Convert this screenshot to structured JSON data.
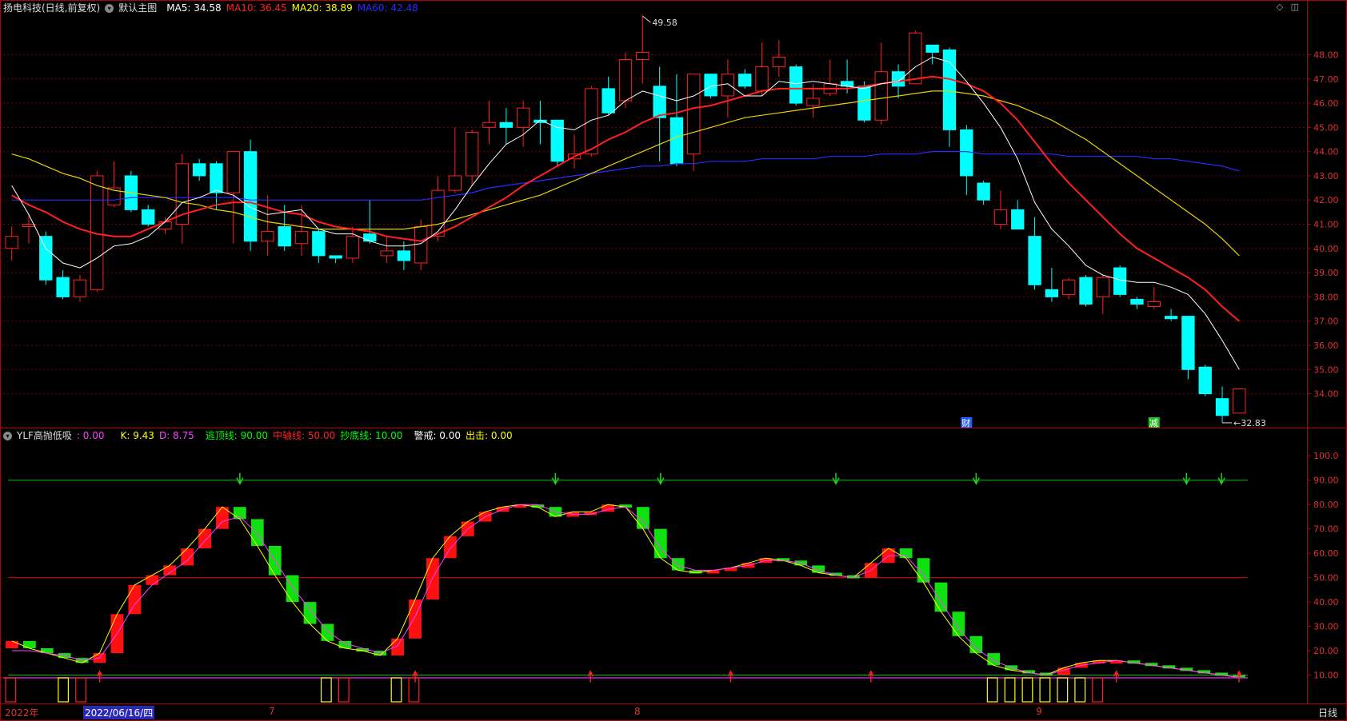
{
  "main": {
    "title": "扬电科技(日线,前复权)",
    "chart_name": "默认主图",
    "ma": [
      {
        "label": "MA5: 34.58",
        "color": "#ffffff"
      },
      {
        "label": "MA10: 36.45",
        "color": "#ff2020"
      },
      {
        "label": "MA20: 38.89",
        "color": "#ffff00"
      },
      {
        "label": "MA60: 42.48",
        "color": "#2b2bff"
      }
    ],
    "high_label": "49.58",
    "low_label": "32.83",
    "event_labels": [
      "财",
      "减"
    ]
  },
  "indicator": {
    "name": "YLF高抛低吸",
    "values": [
      {
        "label": ": 0.00",
        "color": "#ff40ff"
      },
      {
        "label": "K: 9.43",
        "color": "#ffff00"
      },
      {
        "label": "D: 8.75",
        "color": "#ff40ff"
      },
      {
        "label": "逃顶线: 90.00",
        "color": "#00ff00"
      },
      {
        "label": "中轴线: 50.00",
        "color": "#ff2020"
      },
      {
        "label": "抄底线: 10.00",
        "color": "#00ff00"
      },
      {
        "label": "警戒: 0.00",
        "color": "#ffffff"
      },
      {
        "label": "出击: 0.00",
        "color": "#ffff00"
      }
    ]
  },
  "footer": {
    "year_label": "2022年",
    "selected_date": "2022/06/16/四",
    "months": [
      "7",
      "8",
      "9"
    ],
    "period": "日线"
  },
  "colors": {
    "up": "#ff2020",
    "down": "#00ffff",
    "ma5": "#ffffff",
    "ma10": "#ff2020",
    "ma20": "#e6d200",
    "ma60": "#2b2bff",
    "k_up": "#ff1010",
    "k_down": "#10e010",
    "grid": "#7a0000",
    "border": "#b00000"
  },
  "chart_data": [
    {
      "type": "candlestick",
      "title": "扬电科技(日线,前复权)",
      "ylim": [
        32.6,
        49.6
      ],
      "yticks": [
        "34.00",
        "35.00",
        "36.00",
        "37.00",
        "38.00",
        "39.00",
        "40.00",
        "41.00",
        "42.00",
        "43.00",
        "44.00",
        "45.00",
        "46.00",
        "47.00",
        "48.00"
      ],
      "ohlc": [
        [
          40.0,
          40.5,
          39.5,
          40.9
        ],
        [
          40.9,
          41.0,
          40.2,
          41.4
        ],
        [
          40.5,
          38.7,
          38.5,
          40.7
        ],
        [
          38.8,
          38.0,
          37.9,
          39.1
        ],
        [
          38.0,
          38.7,
          37.8,
          38.9
        ],
        [
          38.3,
          43.0,
          38.2,
          43.2
        ],
        [
          41.8,
          42.5,
          41.7,
          43.6
        ],
        [
          43.0,
          41.6,
          41.5,
          43.2
        ],
        [
          41.6,
          41.0,
          40.9,
          41.8
        ],
        [
          40.8,
          41.1,
          40.6,
          41.3
        ],
        [
          41.0,
          43.5,
          40.2,
          43.9
        ],
        [
          43.5,
          43.0,
          42.8,
          43.7
        ],
        [
          43.5,
          42.3,
          41.6,
          43.6
        ],
        [
          42.3,
          44.0,
          40.2,
          44.0
        ],
        [
          44.0,
          40.3,
          39.9,
          44.5
        ],
        [
          40.3,
          40.7,
          39.7,
          42.2
        ],
        [
          40.9,
          40.1,
          39.9,
          41.8
        ],
        [
          40.2,
          40.7,
          39.7,
          41.8
        ],
        [
          40.7,
          39.7,
          39.4,
          40.8
        ],
        [
          39.7,
          39.6,
          39.4,
          39.7
        ],
        [
          39.6,
          40.5,
          39.4,
          40.9
        ],
        [
          40.6,
          40.3,
          40.2,
          42.0
        ],
        [
          39.7,
          39.9,
          39.4,
          40.5
        ],
        [
          39.9,
          39.5,
          39.1,
          40.3
        ],
        [
          39.4,
          40.9,
          39.1,
          41.2
        ],
        [
          40.5,
          42.4,
          40.3,
          43.0
        ],
        [
          42.4,
          43.0,
          42.3,
          45.0
        ],
        [
          43.0,
          44.8,
          42.6,
          44.9
        ],
        [
          45.0,
          45.2,
          44.3,
          46.1
        ],
        [
          45.2,
          45.0,
          44.3,
          45.8
        ],
        [
          45.0,
          45.8,
          44.2,
          46.1
        ],
        [
          45.3,
          45.2,
          44.3,
          46.1
        ],
        [
          45.3,
          43.6,
          43.4,
          45.3
        ],
        [
          43.7,
          43.9,
          43.3,
          44.7
        ],
        [
          43.9,
          46.6,
          43.8,
          46.7
        ],
        [
          46.6,
          45.6,
          45.5,
          47.1
        ],
        [
          46.1,
          47.8,
          45.8,
          48.1
        ],
        [
          47.8,
          48.1,
          46.8,
          49.6
        ],
        [
          46.7,
          45.4,
          43.6,
          47.5
        ],
        [
          45.4,
          43.5,
          43.4,
          47.2
        ],
        [
          43.9,
          47.2,
          43.2,
          47.2
        ],
        [
          47.2,
          46.3,
          46.2,
          47.2
        ],
        [
          46.3,
          47.2,
          45.4,
          47.8
        ],
        [
          47.2,
          46.7,
          46.6,
          47.4
        ],
        [
          46.5,
          47.5,
          46.3,
          48.5
        ],
        [
          47.5,
          47.9,
          47.1,
          48.6
        ],
        [
          47.5,
          46.0,
          45.9,
          47.6
        ],
        [
          45.9,
          46.2,
          45.4,
          46.8
        ],
        [
          46.4,
          46.8,
          46.3,
          47.8
        ],
        [
          46.9,
          46.7,
          46.4,
          47.8
        ],
        [
          46.7,
          45.3,
          45.2,
          46.9
        ],
        [
          45.3,
          47.3,
          45.1,
          48.5
        ],
        [
          47.3,
          46.7,
          46.2,
          47.6
        ],
        [
          46.8,
          48.9,
          46.8,
          49.0
        ],
        [
          48.4,
          48.1,
          47.6,
          48.4
        ],
        [
          48.2,
          44.9,
          44.2,
          48.3
        ],
        [
          44.9,
          43.0,
          42.2,
          45.1
        ],
        [
          42.7,
          42.0,
          41.8,
          42.8
        ],
        [
          41.0,
          41.6,
          40.8,
          42.4
        ],
        [
          41.6,
          40.8,
          40.8,
          42.0
        ],
        [
          40.5,
          38.5,
          38.3,
          41.3
        ],
        [
          38.3,
          38.0,
          37.8,
          39.2
        ],
        [
          38.1,
          38.7,
          37.9,
          38.8
        ],
        [
          38.8,
          37.7,
          37.6,
          38.9
        ],
        [
          38.0,
          38.8,
          37.3,
          38.9
        ],
        [
          39.2,
          38.1,
          38.0,
          39.3
        ],
        [
          37.9,
          37.7,
          37.5,
          38.0
        ],
        [
          37.6,
          37.8,
          37.5,
          38.4
        ],
        [
          37.2,
          37.1,
          37.0,
          37.5
        ],
        [
          37.2,
          35.0,
          34.6,
          37.2
        ],
        [
          35.1,
          34.0,
          33.9,
          35.2
        ],
        [
          33.8,
          33.1,
          32.8,
          34.3
        ],
        [
          33.2,
          34.2,
          33.2,
          34.2
        ]
      ],
      "ma5": [
        42.6,
        41.4,
        40.0,
        39.4,
        39.2,
        39.6,
        40.1,
        40.2,
        40.5,
        41.1,
        41.9,
        42.1,
        42.4,
        42.2,
        41.7,
        41.4,
        41.5,
        41.6,
        40.8,
        40.6,
        40.6,
        40.3,
        40.1,
        40.1,
        40.2,
        40.7,
        41.6,
        42.6,
        43.5,
        44.3,
        44.7,
        45.3,
        45.0,
        44.9,
        45.3,
        45.5,
        46.1,
        46.5,
        46.3,
        46.1,
        46.3,
        46.7,
        46.8,
        46.3,
        46.3,
        46.9,
        46.8,
        46.9,
        46.8,
        46.7,
        46.6,
        46.8,
        46.9,
        47.5,
        47.9,
        47.7,
        46.9,
        46.0,
        45.0,
        43.7,
        41.9,
        40.8,
        40.1,
        39.3,
        38.9,
        38.7,
        38.6,
        38.6,
        38.4,
        38.1,
        37.3,
        36.2,
        35.0
      ],
      "ma10": [
        42.2,
        41.8,
        41.5,
        41.1,
        40.8,
        40.6,
        40.5,
        40.5,
        40.8,
        41.1,
        41.4,
        41.6,
        41.8,
        41.9,
        41.9,
        41.7,
        41.5,
        41.4,
        41.1,
        40.9,
        40.8,
        40.7,
        40.5,
        40.4,
        40.3,
        40.6,
        40.9,
        41.3,
        41.7,
        42.1,
        42.6,
        43.0,
        43.4,
        43.8,
        44.1,
        44.5,
        44.8,
        45.2,
        45.5,
        45.6,
        45.8,
        45.9,
        46.1,
        46.3,
        46.5,
        46.6,
        46.6,
        46.6,
        46.6,
        46.6,
        46.7,
        46.8,
        46.9,
        47.0,
        47.1,
        47.0,
        46.8,
        46.5,
        46.0,
        45.3,
        44.4,
        43.5,
        42.7,
        42.0,
        41.3,
        40.6,
        40.0,
        39.6,
        39.2,
        38.8,
        38.3,
        37.6,
        37.0
      ],
      "ma20": [
        43.9,
        43.7,
        43.4,
        43.1,
        42.9,
        42.6,
        42.4,
        42.3,
        42.2,
        42.1,
        41.9,
        41.8,
        41.6,
        41.5,
        41.3,
        41.1,
        41.0,
        40.9,
        40.8,
        40.8,
        40.8,
        40.8,
        40.8,
        40.8,
        40.9,
        41.0,
        41.2,
        41.4,
        41.6,
        41.8,
        42.0,
        42.2,
        42.5,
        42.8,
        43.1,
        43.4,
        43.7,
        44.0,
        44.3,
        44.6,
        44.8,
        45.0,
        45.2,
        45.4,
        45.5,
        45.6,
        45.7,
        45.8,
        45.9,
        46.0,
        46.1,
        46.2,
        46.3,
        46.4,
        46.5,
        46.5,
        46.4,
        46.3,
        46.1,
        45.9,
        45.6,
        45.3,
        44.9,
        44.5,
        44.0,
        43.5,
        43.0,
        42.5,
        42.0,
        41.5,
        41.0,
        40.4,
        39.7
      ],
      "ma60": [
        42.0,
        42.0,
        42.0,
        42.0,
        42.0,
        42.0,
        42.0,
        42.1,
        42.1,
        42.1,
        42.1,
        42.1,
        42.1,
        42.1,
        42.0,
        42.0,
        42.0,
        42.0,
        42.0,
        42.0,
        42.0,
        42.0,
        42.0,
        42.0,
        42.0,
        42.1,
        42.2,
        42.3,
        42.5,
        42.6,
        42.7,
        42.8,
        42.9,
        43.0,
        43.1,
        43.2,
        43.3,
        43.4,
        43.4,
        43.5,
        43.5,
        43.6,
        43.6,
        43.6,
        43.7,
        43.7,
        43.7,
        43.7,
        43.8,
        43.8,
        43.8,
        43.9,
        43.9,
        43.9,
        44.0,
        44.0,
        44.0,
        43.9,
        43.9,
        43.9,
        43.9,
        43.9,
        43.8,
        43.8,
        43.8,
        43.8,
        43.8,
        43.7,
        43.7,
        43.6,
        43.5,
        43.4,
        43.2
      ]
    },
    {
      "type": "indicator",
      "title": "YLF高抛低吸",
      "ylim": [
        0,
        105
      ],
      "yticks": [
        "10.00",
        "20.00",
        "30.00",
        "40.00",
        "50.00",
        "60.00",
        "70.00",
        "80.00",
        "90.00",
        "100.0"
      ],
      "levels": [
        90,
        50,
        10
      ],
      "k": [
        24,
        21,
        19,
        17,
        15,
        19,
        35,
        47,
        51,
        55,
        62,
        70,
        79,
        74,
        63,
        51,
        40,
        31,
        24,
        21,
        20,
        18,
        25,
        41,
        58,
        67,
        73,
        77,
        79,
        80,
        79,
        75,
        77,
        77,
        80,
        79,
        70,
        58,
        53,
        52,
        53,
        54,
        56,
        58,
        57,
        55,
        52,
        51,
        50,
        56,
        62,
        58,
        48,
        36,
        26,
        19,
        14,
        12,
        11,
        10,
        13,
        15,
        16,
        16,
        15,
        14,
        13,
        12,
        11,
        10,
        9
      ],
      "d": [
        20,
        20,
        19,
        18,
        16,
        17,
        27,
        39,
        47,
        52,
        57,
        65,
        73,
        75,
        68,
        57,
        46,
        37,
        28,
        23,
        21,
        19,
        22,
        34,
        50,
        62,
        70,
        75,
        78,
        80,
        80,
        77,
        76,
        76,
        78,
        79,
        73,
        62,
        55,
        53,
        53,
        54,
        55,
        57,
        57,
        56,
        53,
        51,
        50,
        53,
        59,
        59,
        51,
        40,
        29,
        21,
        16,
        13,
        11,
        10,
        12,
        14,
        15,
        16,
        15,
        14,
        13,
        12,
        11,
        10,
        9
      ]
    }
  ]
}
